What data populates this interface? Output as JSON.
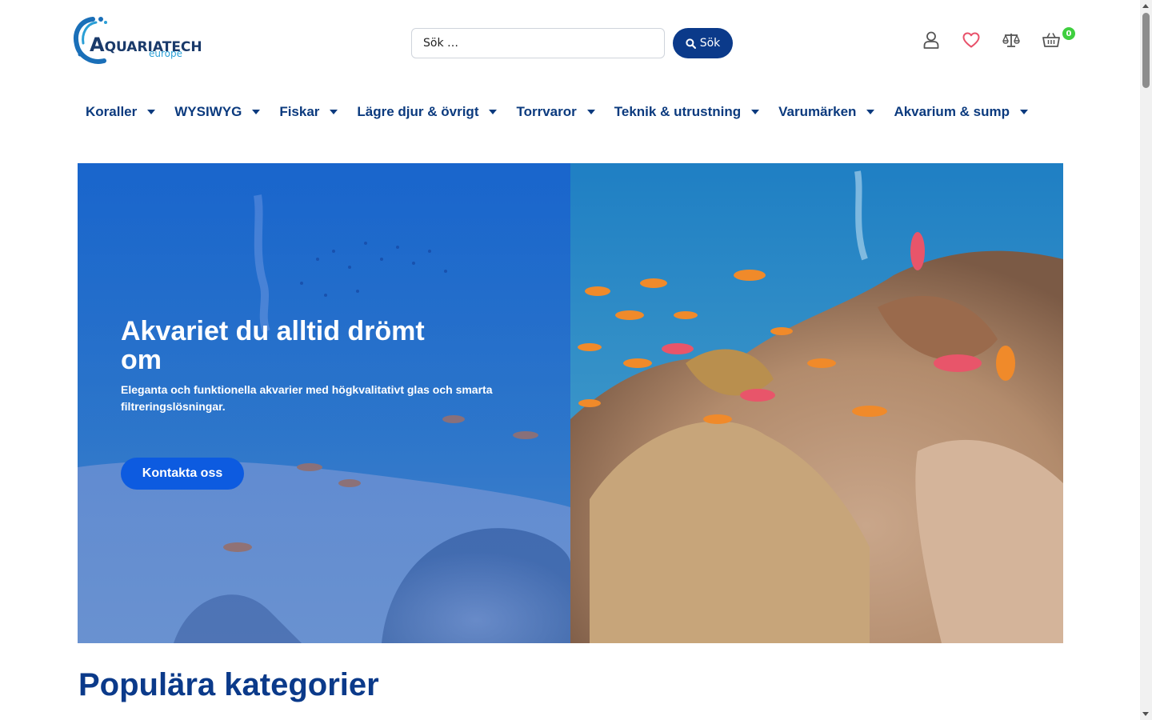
{
  "header": {
    "logo": {
      "main_initial": "A",
      "main_rest": "QUARIATECH",
      "sub": "europe"
    },
    "search": {
      "placeholder": "Sök …",
      "button_label": "Sök"
    },
    "icons": {
      "account": "user-icon",
      "wishlist": "heart-icon",
      "compare": "scale-icon",
      "cart": "basket-icon"
    },
    "cart_count": "0"
  },
  "nav": {
    "items": [
      {
        "label": "Koraller"
      },
      {
        "label": "WYSIWYG"
      },
      {
        "label": "Fiskar"
      },
      {
        "label": "Lägre djur & övrigt"
      },
      {
        "label": "Torrvaror"
      },
      {
        "label": "Teknik & utrustning"
      },
      {
        "label": "Varumärken"
      },
      {
        "label": "Akvarium & sump"
      }
    ]
  },
  "hero": {
    "title": "Akvariet du alltid drömt om",
    "subtitle": "Eleganta och funktionella akvarier med högkvalitativt glas och smarta filtreringslösningar.",
    "button_label": "Kontakta oss"
  },
  "sections": {
    "popular_title": "Populära kategorier"
  },
  "colors": {
    "brand_navy": "#0b3a8a",
    "hero_button": "#0d5be0",
    "cart_badge": "#3fcf3f",
    "heart": "#e8516a"
  }
}
